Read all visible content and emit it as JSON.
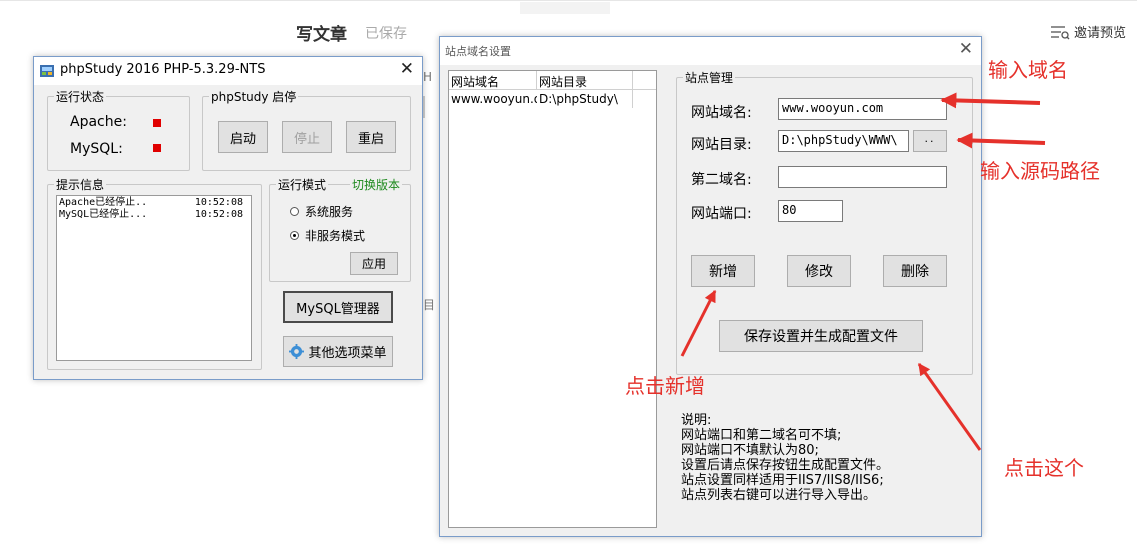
{
  "editor": {
    "title": "写文章",
    "saved": "已保存",
    "preview_label": "邀请预览",
    "fragment_a": "H",
    "fragment_b": "目"
  },
  "phpstudy": {
    "title": "phpStudy 2016   PHP-5.3.29-NTS",
    "status_group": "运行状态",
    "apache_label": "Apache:",
    "mysql_label": "MySQL:",
    "status_color": "#e00000",
    "control_group": "phpStudy 启停",
    "start_button": "启动",
    "stop_button": "停止",
    "restart_button": "重启",
    "info_group": "提示信息",
    "log": [
      {
        "text": "Apache已经停止..",
        "time": "10:52:08"
      },
      {
        "text": "MySQL已经停止...",
        "time": "10:52:08"
      }
    ],
    "mode_group": "运行模式",
    "switch_version": "切换版本",
    "mode_system": "系统服务",
    "mode_nonservice": "非服务模式",
    "apply_button": "应用",
    "mysql_manager_button": "MySQL管理器",
    "other_menu_button": "其他选项菜单"
  },
  "site_dialog": {
    "title": "站点域名设置",
    "list_headers": [
      "网站域名",
      "网站目录"
    ],
    "list_rows": [
      [
        "www.wooyun.o",
        "D:\\phpStudy\\"
      ]
    ],
    "manage_group": "站点管理",
    "domain_label": "网站域名:",
    "domain_value": "www.wooyun.com",
    "dir_label": "网站目录:",
    "dir_value": "D:\\phpStudy\\WWW\\",
    "browse_button": "··",
    "second_label": "第二域名:",
    "second_value": "",
    "port_label": "网站端口:",
    "port_value": "80",
    "add_button": "新增",
    "modify_button": "修改",
    "delete_button": "删除",
    "save_button": "保存设置并生成配置文件",
    "notes": [
      "说明:",
      "网站端口和第二域名可不填;",
      "网站端口不填默认为80;",
      "设置后请点保存按钮生成配置文件。",
      "站点设置同样适用于IIS7/IIS8/IIS6;",
      "站点列表右键可以进行导入导出。"
    ]
  },
  "annotations": {
    "enter_domain": "输入域名",
    "enter_source_path": "输入源码路径",
    "click_add": "点击新增",
    "click_this": "点击这个",
    "color": "#e5312b"
  }
}
